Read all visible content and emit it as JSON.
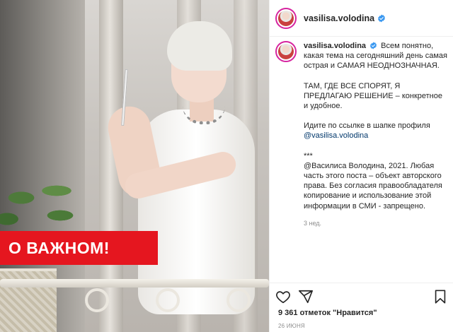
{
  "post": {
    "banner_text": "О ВАЖНОМ!",
    "author": {
      "username": "vasilisa.volodina",
      "verified": true
    },
    "caption": {
      "username": "vasilisa.volodina",
      "paragraphs": [
        "Всем понятно, какая тема на сегодняшний день самая острая и САМАЯ НЕОДНОЗНАЧНАЯ.",
        "ТАМ, ГДЕ ВСЕ СПОРЯТ, Я ПРЕДЛАГАЮ РЕШЕНИЕ – конкретное и удобное.",
        "Идите по ссылке в шапке профиля",
        "***",
        "@Василиса Володина, 2021. Любая часть этого поста – объект авторского права. Без согласия правообладателя копирование и использование этой информации в СМИ - запрещено."
      ],
      "profile_mention": "@vasilisa.volodina",
      "time_ago": "3 нед."
    },
    "likes_text": "9 361 отметок \"Нравится\"",
    "date_text": "26 ИЮНЯ",
    "icons": {
      "like": "heart-outline-icon",
      "share": "paper-plane-icon",
      "save": "bookmark-icon",
      "verified": "verified-badge-icon"
    },
    "colors": {
      "banner": "#e5161f",
      "verified": "#3897f0",
      "text": "#262626",
      "muted": "#8e8e8e",
      "mention": "#00376b"
    }
  }
}
